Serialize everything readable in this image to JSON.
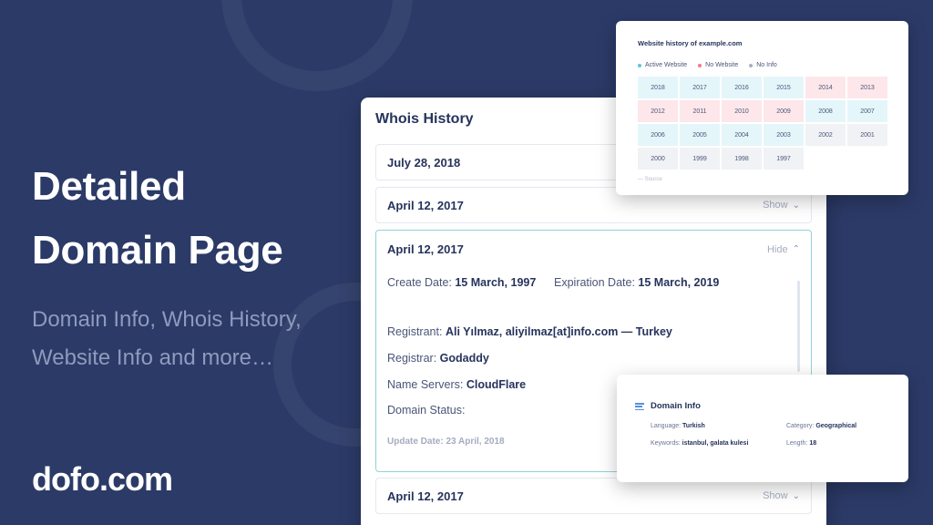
{
  "hero": {
    "title_line1": "Detailed",
    "title_line2": "Domain Page",
    "subtitle_line1": "Domain Info, Whois History,",
    "subtitle_line2": "Website Info and more…",
    "brand": "dofo.com"
  },
  "whois": {
    "title": "Whois History",
    "rows": [
      {
        "date": "July 28, 2018",
        "toggle": ""
      },
      {
        "date": "April 12, 2017",
        "toggle": "Show"
      },
      {
        "date": "April 12, 2017",
        "toggle": "Hide"
      },
      {
        "date": "April 12, 2017",
        "toggle": "Show"
      }
    ],
    "details": {
      "create_label": "Create Date:",
      "create_value": "15 March, 1997",
      "expiration_label": "Expiration Date:",
      "expiration_value": "15 March, 2019",
      "registrant_label": "Registrant:",
      "registrant_value": "Ali Yılmaz, aliyilmaz[at]info.com — Turkey",
      "registrar_label": "Registrar:",
      "registrar_value": "Godaddy",
      "nameservers_label": "Name Servers:",
      "nameservers_value": "CloudFlare",
      "status_label": "Domain Status:",
      "update_date": "Update Date: 23 April, 2018"
    }
  },
  "history": {
    "title": "Website history of example.com",
    "legend": [
      {
        "label": "Active Website",
        "color": "#5bc6e0"
      },
      {
        "label": "No Website",
        "color": "#f07a8a"
      },
      {
        "label": "No Info",
        "color": "#a8b0c2"
      }
    ],
    "cells": [
      {
        "year": "2018",
        "state": "active"
      },
      {
        "year": "2017",
        "state": "active"
      },
      {
        "year": "2016",
        "state": "active"
      },
      {
        "year": "2015",
        "state": "active"
      },
      {
        "year": "2014",
        "state": "none"
      },
      {
        "year": "2013",
        "state": "none"
      },
      {
        "year": "2012",
        "state": "none"
      },
      {
        "year": "2011",
        "state": "none"
      },
      {
        "year": "2010",
        "state": "none"
      },
      {
        "year": "2009",
        "state": "none"
      },
      {
        "year": "2008",
        "state": "active"
      },
      {
        "year": "2007",
        "state": "active"
      },
      {
        "year": "2006",
        "state": "active"
      },
      {
        "year": "2005",
        "state": "active"
      },
      {
        "year": "2004",
        "state": "active"
      },
      {
        "year": "2003",
        "state": "active"
      },
      {
        "year": "2002",
        "state": "noinfo"
      },
      {
        "year": "2001",
        "state": "noinfo"
      },
      {
        "year": "2000",
        "state": "noinfo"
      },
      {
        "year": "1999",
        "state": "noinfo"
      },
      {
        "year": "1998",
        "state": "noinfo"
      },
      {
        "year": "1997",
        "state": "noinfo"
      }
    ],
    "state_colors": {
      "active": "#e5f6fa",
      "none": "#fde7ea",
      "noinfo": "#f1f2f5"
    },
    "source": "— Source"
  },
  "info": {
    "title": "Domain Info",
    "language_label": "Language:",
    "language_value": "Turkish",
    "keywords_label": "Keywords:",
    "keywords_value": "istanbul, galata kulesi",
    "category_label": "Category:",
    "category_value": "Geographical",
    "length_label": "Length:",
    "length_value": "18"
  }
}
